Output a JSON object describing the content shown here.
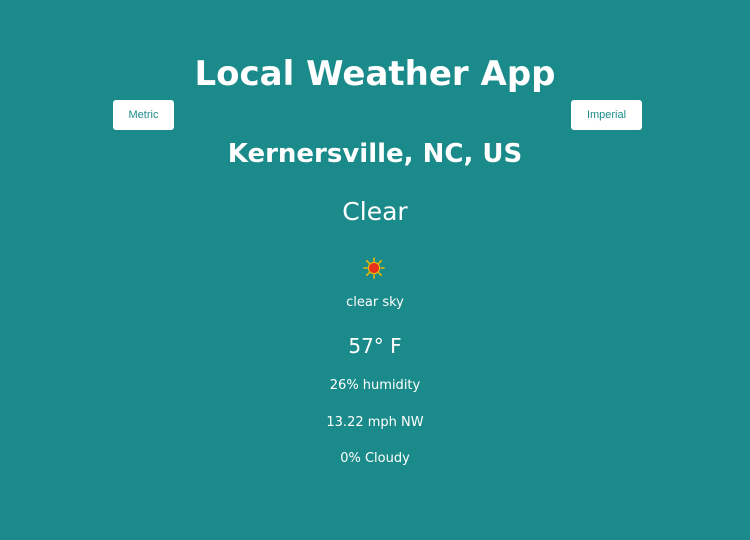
{
  "app": {
    "title": "Local Weather App",
    "background_color": "#1b8a8a"
  },
  "units": {
    "metric_label": "Metric",
    "imperial_label": "Imperial"
  },
  "weather": {
    "location": "Kernersville, NC, US",
    "condition": "Clear",
    "icon": "sun-icon",
    "description": "clear sky",
    "temperature": "57° F",
    "humidity": "26% humidity",
    "wind": "13.22 mph NW",
    "cloudiness": "0% Cloudy"
  }
}
